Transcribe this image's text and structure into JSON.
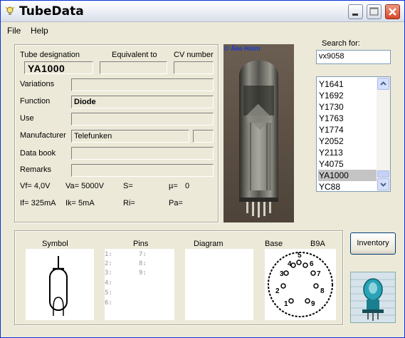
{
  "window": {
    "title": "TubeData"
  },
  "menu": {
    "file": "File",
    "help": "Help"
  },
  "labels": {
    "tube_designation": "Tube designation",
    "equivalent_to": "Equivalent to",
    "cv_number": "CV number",
    "variations": "Variations",
    "function": "Function",
    "use": "Use",
    "manufacturer": "Manufacturer",
    "data_book": "Data book",
    "remarks": "Remarks"
  },
  "tube": {
    "designation": "YA1000",
    "equivalent": "",
    "cv_number": "",
    "variations": "",
    "function": "Diode",
    "use": "",
    "manufacturer": "Telefunken",
    "manufacturer_code": "",
    "data_book": "",
    "remarks": ""
  },
  "params": {
    "vf": "Vf= 4,0V",
    "va": "Va= 5000V",
    "s": "S=",
    "mu": "µ=",
    "mu_value": "0",
    "if": "If= 325mA",
    "ik": "Ik=  5mA",
    "ri": "Ri=",
    "pa": "Pa="
  },
  "photo": {
    "copyright": "© Åke Holm"
  },
  "search": {
    "label": "Search for:",
    "value": "vx9058",
    "results": [
      "Y1641",
      "Y1692",
      "Y1730",
      "Y1763",
      "Y1774",
      "Y2052",
      "Y2113",
      "Y4075",
      "YA1000",
      "YC88"
    ],
    "selected": "YA1000"
  },
  "bottom": {
    "symbol": "Symbol",
    "pins": "Pins",
    "diagram": "Diagram",
    "base": "Base",
    "base_type": "B9A",
    "pin_numbers": [
      "1:",
      "2:",
      "3:",
      "4:",
      "5:",
      "6:",
      "7:",
      "8:",
      "9:"
    ]
  },
  "buttons": {
    "inventory": "Inventory"
  }
}
